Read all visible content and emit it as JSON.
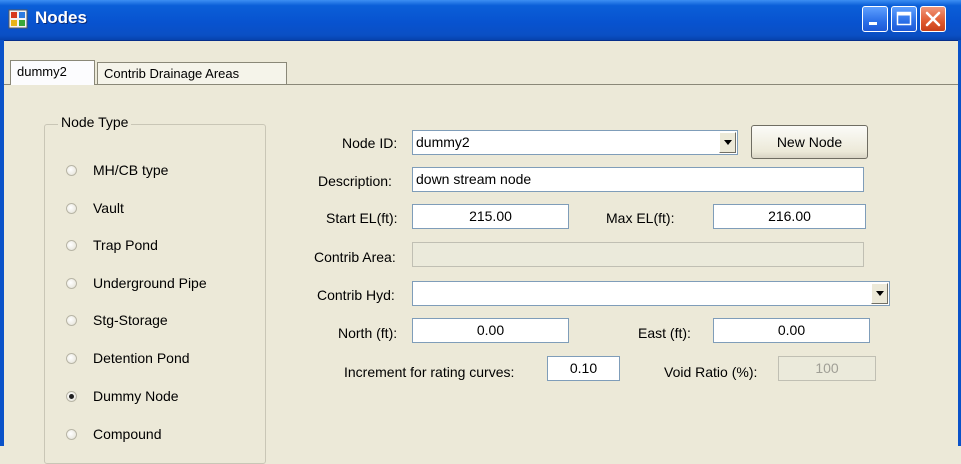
{
  "window": {
    "title": "Nodes"
  },
  "tabs": [
    {
      "label": "dummy2"
    },
    {
      "label": "Contrib Drainage Areas"
    }
  ],
  "node_type": {
    "label": "Node Type",
    "options": [
      {
        "label": "MH/CB type",
        "checked": false
      },
      {
        "label": "Vault",
        "checked": false
      },
      {
        "label": "Trap Pond",
        "checked": false
      },
      {
        "label": "Underground Pipe",
        "checked": false
      },
      {
        "label": "Stg-Storage",
        "checked": false
      },
      {
        "label": "Detention Pond",
        "checked": false
      },
      {
        "label": "Dummy Node",
        "checked": true
      },
      {
        "label": "Compound",
        "checked": false
      }
    ]
  },
  "form": {
    "node_id_label": "Node ID:",
    "node_id_value": "dummy2",
    "new_node_label": "New Node",
    "description_label": "Description:",
    "description_value": "down stream node",
    "start_el_label": "Start EL(ft):",
    "start_el_value": "215.00",
    "max_el_label": "Max EL(ft):",
    "max_el_value": "216.00",
    "contrib_area_label": "Contrib Area:",
    "contrib_area_value": "",
    "contrib_hyd_label": "Contrib Hyd:",
    "contrib_hyd_value": "",
    "north_label": "North (ft):",
    "north_value": "0.00",
    "east_label": "East (ft):",
    "east_value": "0.00",
    "increment_label": "Increment for rating curves:",
    "increment_value": "0.10",
    "void_ratio_label": "Void Ratio (%):",
    "void_ratio_value": "100"
  }
}
